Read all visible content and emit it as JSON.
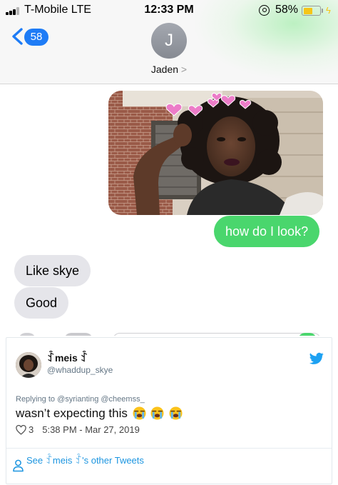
{
  "status_bar": {
    "carrier": "T-Mobile  LTE",
    "time": "12:33 PM",
    "battery": "58%",
    "battery_level": 0.58
  },
  "conversation": {
    "back_count": "58",
    "avatar_initial": "J",
    "contact_name": "Jaden",
    "contact_chevron": ">",
    "messages": [
      {
        "from": "me",
        "text": "how do I look?"
      },
      {
        "from": "them",
        "text": "Like skye"
      },
      {
        "from": "them",
        "text": "Good"
      }
    ]
  },
  "tweet": {
    "display_name": "ꉗmeis ꉗ",
    "handle": "@whaddup_skye",
    "replying_to": "Replying to @syrianting @cheemss_",
    "text": "wasn’t expecting this",
    "likes": "3",
    "timestamp": "5:38 PM - Mar 27, 2019",
    "see_more": "See ꉗmeis ꉗ's other Tweets"
  },
  "colors": {
    "imessage_blue": "#1e7cf6",
    "sent_bubble": "#4ad66d",
    "received_bubble": "#e5e5ea",
    "twitter_blue": "#1da1f2",
    "battery_yellow": "#f5c518"
  }
}
